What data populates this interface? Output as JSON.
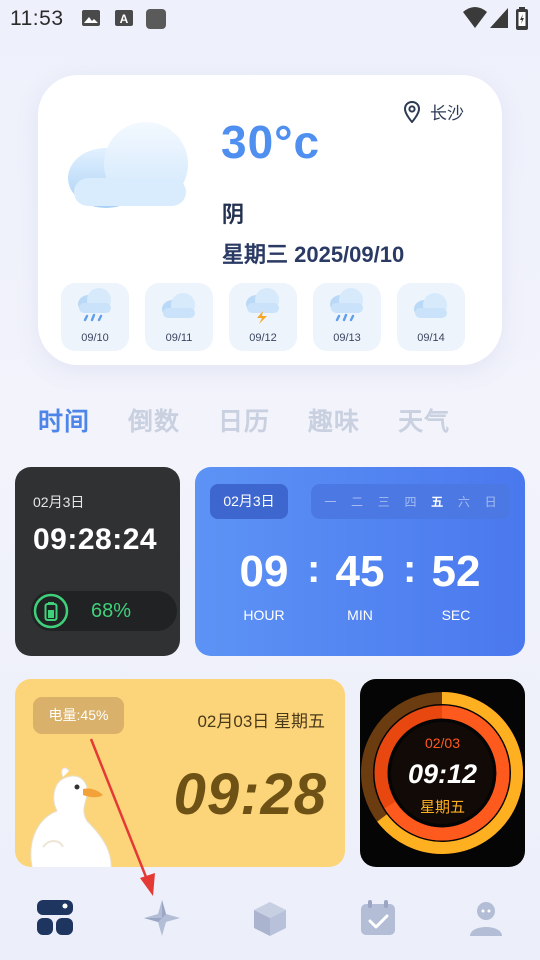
{
  "status_bar": {
    "time": "11:53",
    "icons": [
      "image-icon",
      "text-a-icon",
      "square-app-icon"
    ],
    "right_icons": [
      "wifi-icon",
      "signal-icon",
      "battery-icon"
    ]
  },
  "weather": {
    "location": "长沙",
    "temperature": "30°c",
    "condition": "阴",
    "date": "星期三 2025/09/10",
    "forecast": [
      {
        "date": "09/10",
        "icon": "rain-cloud-icon"
      },
      {
        "date": "09/11",
        "icon": "cloud-icon"
      },
      {
        "date": "09/12",
        "icon": "thunder-cloud-icon"
      },
      {
        "date": "09/13",
        "icon": "rain-cloud-icon"
      },
      {
        "date": "09/14",
        "icon": "cloud-icon"
      }
    ]
  },
  "tabs": [
    {
      "label": "时间",
      "active": true
    },
    {
      "label": "倒数",
      "active": false
    },
    {
      "label": "日历",
      "active": false
    },
    {
      "label": "趣味",
      "active": false
    },
    {
      "label": "天气",
      "active": false
    }
  ],
  "widget_dark": {
    "date": "02月3日",
    "time": "09:28:24",
    "battery": "68%",
    "battery_level": 0.68
  },
  "widget_blue": {
    "date": "02月3日",
    "weekdays": [
      "一",
      "二",
      "三",
      "四",
      "五",
      "六",
      "日"
    ],
    "active_weekday_index": 4,
    "hour": "09",
    "minute": "45",
    "second": "52",
    "hour_label": "HOUR",
    "min_label": "MIN",
    "sec_label": "SEC"
  },
  "widget_yellow": {
    "battery": "电量:45%",
    "date": "02月03日 星期五",
    "time": "09:28"
  },
  "widget_black": {
    "date": "02/03",
    "time": "09:12",
    "weekday": "星期五"
  },
  "bottom_nav": [
    {
      "name": "nav-widgets",
      "icon": "widgets-icon",
      "active": true
    },
    {
      "name": "nav-discover",
      "icon": "compass-icon",
      "active": false
    },
    {
      "name": "nav-box",
      "icon": "cube-icon",
      "active": false
    },
    {
      "name": "nav-calendar",
      "icon": "calendar-check-icon",
      "active": false
    },
    {
      "name": "nav-profile",
      "icon": "user-icon",
      "active": false
    }
  ],
  "colors": {
    "accent": "#4d86e8",
    "temp": "#4f8ff0",
    "battery_green": "#3fd07a",
    "widget_blue": "#5d93f5",
    "widget_yellow": "#fcd57a",
    "ring_orange": "#ff5a1e",
    "ring_yellow": "#ffb020",
    "annotation_arrow": "#e53935"
  }
}
